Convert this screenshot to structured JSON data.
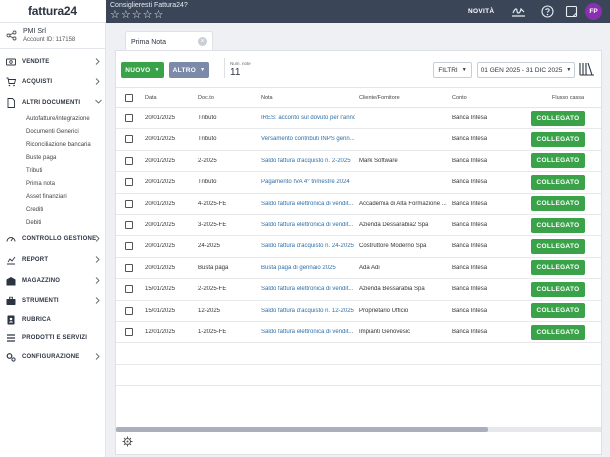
{
  "app": {
    "logo": "fattura24",
    "rate_prompt": "Consiglieresti Fattura24?",
    "stars": [
      "☆",
      "☆",
      "☆",
      "☆",
      "☆"
    ],
    "novita": "NOVITÀ",
    "avatar_initials": "FP",
    "avatar_color": "#8a2fb0"
  },
  "account": {
    "name": "PMI Srl",
    "id": "Account ID: 117158"
  },
  "sidebar": {
    "items": [
      {
        "label": "VENDITE",
        "icon": "money-icon"
      },
      {
        "label": "ACQUISTI",
        "icon": "cart-icon"
      },
      {
        "label": "ALTRI DOCUMENTI",
        "icon": "document-icon"
      },
      {
        "label": "CONTROLLO GESTIONE",
        "icon": "gauge-icon"
      },
      {
        "label": "REPORT",
        "icon": "chart-icon"
      },
      {
        "label": "MAGAZZINO",
        "icon": "warehouse-icon"
      },
      {
        "label": "STRUMENTI",
        "icon": "briefcase-icon"
      },
      {
        "label": "RUBRICA",
        "icon": "address-book-icon"
      },
      {
        "label": "PRODOTTI E SERVIZI",
        "icon": "list-icon"
      },
      {
        "label": "CONFIGURAZIONE",
        "icon": "gears-icon"
      }
    ],
    "subitems": [
      "Autofatture/integrazione",
      "Documenti Generici",
      "Riconciliazione bancaria",
      "Buste paga",
      "Tributi",
      "Prima nota",
      "Asset finanziari",
      "Crediti",
      "Debiti"
    ]
  },
  "tab": {
    "label": "Prima Nota",
    "close": "×"
  },
  "toolbar": {
    "nuovo": "NUOVO",
    "altro": "ALTRO",
    "count_label": "Num. note",
    "count_value": "11",
    "filtri": "FILTRI",
    "date_range": "01 GEN 2025 - 31 DIC 2025"
  },
  "table": {
    "headers": [
      "Data",
      "Doc.to",
      "Nota",
      "Cliente/Fornitore",
      "Conto",
      "Flusso cassa"
    ],
    "button_label": "COLLEGATO",
    "rows": [
      {
        "data": "20/01/2025",
        "doc": "Tributo",
        "nota": "IRES: acconto sul dovuto per l'anno",
        "cliente": "",
        "conto": "Banca Intesa"
      },
      {
        "data": "20/01/2025",
        "doc": "Tributo",
        "nota": "Versamento contributi INPS genn...",
        "cliente": "",
        "conto": "Banca Intesa"
      },
      {
        "data": "20/01/2025",
        "doc": "2-2025",
        "nota": "Saldo fattura d'acquisto n. 2-2025",
        "cliente": "Mark Software",
        "conto": "Banca Intesa"
      },
      {
        "data": "20/01/2025",
        "doc": "Tributo",
        "nota": "Pagamento IVA 4° trimestre 2024",
        "cliente": "",
        "conto": "Banca Intesa"
      },
      {
        "data": "20/01/2025",
        "doc": "4-2025-FE",
        "nota": "Saldo fattura elettronica di vendit...",
        "cliente": "Accademia di Alta Formazione ...",
        "conto": "Banca Intesa"
      },
      {
        "data": "20/01/2025",
        "doc": "3-2025-FE",
        "nota": "Saldo fattura elettronica di vendit...",
        "cliente": "Azienda Dessarabia2 Spa",
        "conto": "Banca Intesa"
      },
      {
        "data": "20/01/2025",
        "doc": "24-2025",
        "nota": "Saldo fattura d'acquisto n. 24-2025",
        "cliente": "Costruttore Moderno Spa",
        "conto": "Banca Intesa"
      },
      {
        "data": "20/01/2025",
        "doc": "Busta paga",
        "nota": "Busta paga di gennaio 2025",
        "cliente": "Ada Adi",
        "conto": "Banca Intesa"
      },
      {
        "data": "15/01/2025",
        "doc": "2-2025-FE",
        "nota": "Saldo fattura elettronica di vendit...",
        "cliente": "Azienda Bessarabia Spa",
        "conto": "Banca Intesa"
      },
      {
        "data": "15/01/2025",
        "doc": "12-2025",
        "nota": "Saldo fattura d'acquisto n. 12-2025",
        "cliente": "Proprietario Ufficio",
        "conto": "Banca Intesa"
      },
      {
        "data": "12/01/2025",
        "doc": "1-2025-FE",
        "nota": "Saldo fattura elettronica di vendit...",
        "cliente": "Impianti Genovesic",
        "conto": "Banca Intesa"
      }
    ]
  },
  "colors": {
    "topbar": "#3a4557",
    "accent_green": "#3aa34a",
    "link_blue": "#2f6fa8"
  }
}
